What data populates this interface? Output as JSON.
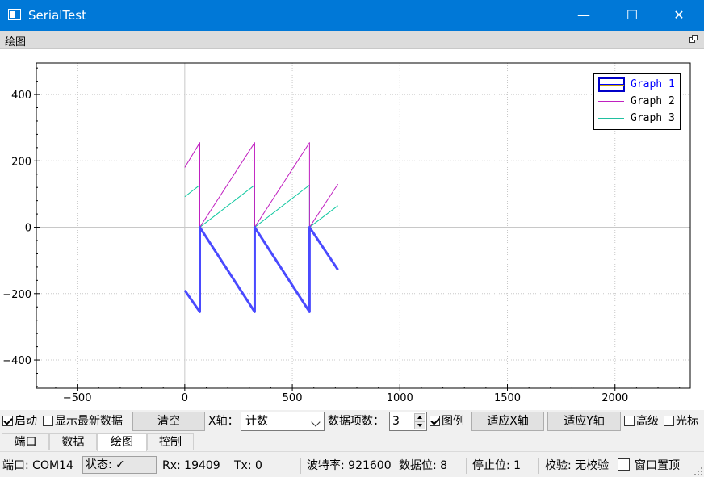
{
  "window": {
    "title": "SerialTest",
    "minimize_label": "—",
    "maximize_label": "☐",
    "close_label": "✕"
  },
  "dock": {
    "title": "绘图"
  },
  "legend": {
    "items": [
      {
        "label": "Graph 1",
        "color": "#0000ff",
        "selected": true
      },
      {
        "label": "Graph 2",
        "color": "#c020c0"
      },
      {
        "label": "Graph 3",
        "color": "#20c0a0"
      }
    ]
  },
  "chart_data": {
    "type": "line",
    "xlim": [
      -690,
      2350
    ],
    "ylim": [
      -485,
      495
    ],
    "x_ticks": [
      -500,
      0,
      500,
      1000,
      1500,
      2000
    ],
    "x_tick_labels": [
      "−500",
      "0",
      "500",
      "1000",
      "1500",
      "2000"
    ],
    "y_ticks": [
      -400,
      -200,
      0,
      200,
      400
    ],
    "y_tick_labels": [
      "−400",
      "−200",
      "0",
      "200",
      "400"
    ],
    "grid": true,
    "legend_position": "top-right",
    "series": [
      {
        "name": "Graph 1",
        "color": "#4a4aff",
        "width": 3,
        "x": [
          0,
          70,
          70,
          325,
          325,
          580,
          580,
          712
        ],
        "y": [
          -190,
          -255,
          0,
          -255,
          0,
          -255,
          0,
          -128
        ]
      },
      {
        "name": "Graph 2",
        "color": "#c020c0",
        "width": 1,
        "x": [
          0,
          70,
          70,
          325,
          325,
          580,
          580,
          712
        ],
        "y": [
          180,
          255,
          0,
          255,
          0,
          255,
          0,
          130
        ]
      },
      {
        "name": "Graph 3",
        "color": "#10c8a0",
        "width": 1,
        "x": [
          0,
          70,
          70,
          325,
          325,
          580,
          580,
          712
        ],
        "y": [
          92,
          127,
          0,
          127,
          0,
          127,
          0,
          65
        ]
      }
    ]
  },
  "toolbar": {
    "start_label": "启动",
    "start_checked": true,
    "latest_label": "显示最新数据",
    "latest_checked": false,
    "clear_label": "清空",
    "xaxis_label": "X轴：",
    "xaxis_value": "计数",
    "count_label": "数据项数：",
    "count_value": "3",
    "legend_label": "图例",
    "legend_checked": true,
    "fitx_label": "适应X轴",
    "fity_label": "适应Y轴",
    "advanced_label": "高级",
    "advanced_checked": false,
    "cursor_label": "光标",
    "cursor_checked": false
  },
  "tabs": [
    {
      "label": "端口"
    },
    {
      "label": "数据"
    },
    {
      "label": "绘图",
      "active": true
    },
    {
      "label": "控制"
    }
  ],
  "status": {
    "port": "端口: COM14",
    "state": "状态: ✓",
    "rx": "Rx: 19409",
    "tx": "Tx: 0",
    "baud": "波特率: 921600",
    "databits": "数据位: 8",
    "stopbits": "停止位: 1",
    "parity": "校验: 无校验",
    "ontop_label": "窗口置顶",
    "ontop_checked": false
  }
}
